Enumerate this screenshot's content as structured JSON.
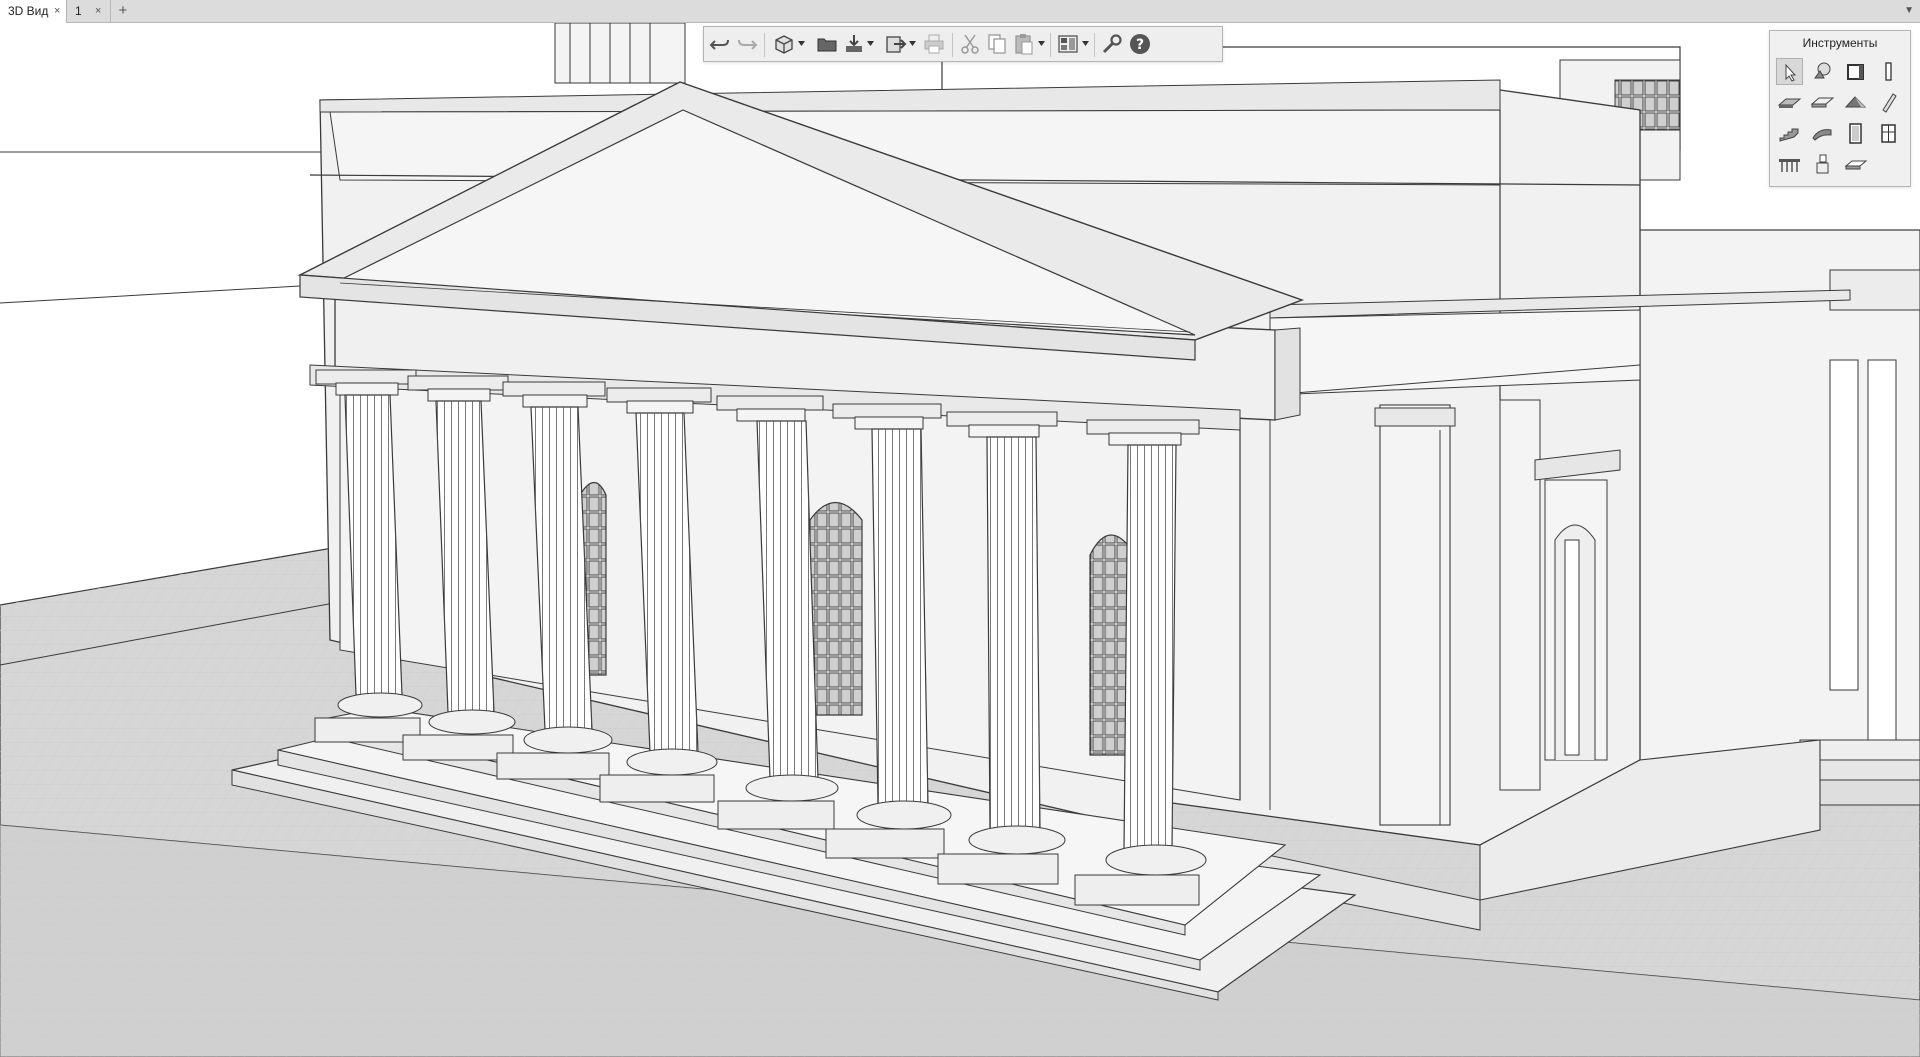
{
  "tabs": [
    {
      "label": "3D Вид",
      "active": true
    },
    {
      "label": "1",
      "active": false
    }
  ],
  "tab_close_glyph": "×",
  "tab_add_glyph": "+",
  "tab_menu_glyph": "▼",
  "toolbar": {
    "buttons": [
      "undo-icon",
      "redo-icon",
      "3d-view-icon",
      "open-folder-icon",
      "import-icon",
      "export-icon",
      "print-icon",
      "cut-icon",
      "copy-icon",
      "paste-icon",
      "layout-icon",
      "settings-wrench-icon",
      "help-icon"
    ]
  },
  "tools_panel": {
    "title": "Инструменты",
    "tools": [
      "select-arrow-icon",
      "object-tool-icon",
      "wall-frame-icon",
      "column-tool-icon",
      "slab-icon",
      "floor-icon",
      "roof-icon",
      "beam-icon",
      "stair-icon",
      "curved-roof-icon",
      "door-icon",
      "window-icon",
      "railing-icon",
      "figure-icon",
      "text-label-icon"
    ]
  },
  "colors": {
    "tabbar": "#dcdcdc",
    "toolbar": "#eeeeee",
    "panel": "#f0f0f0",
    "model_fill": "#f2f2f2",
    "ground": "#d8d8d8",
    "line": "#3a3a3a"
  }
}
